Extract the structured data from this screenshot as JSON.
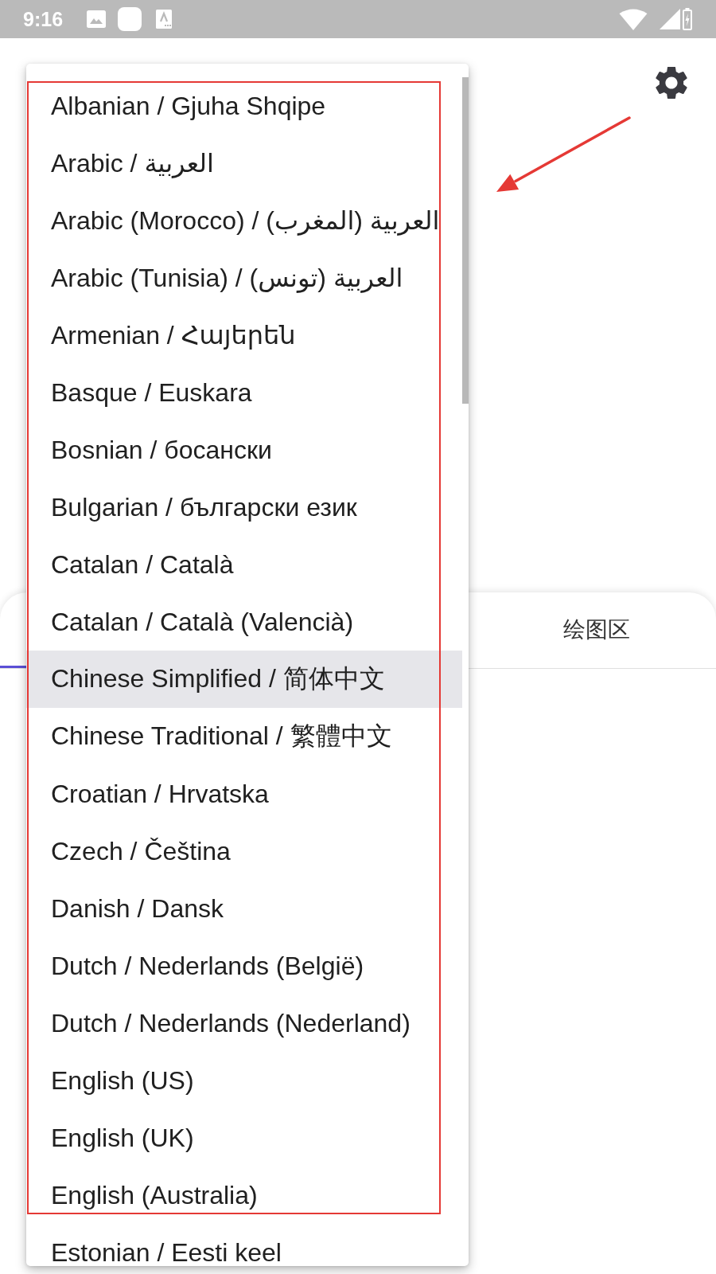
{
  "status_bar": {
    "time": "9:16"
  },
  "tabs": [
    {
      "selected": true
    },
    {
      "label": "绘图区",
      "selected": false
    }
  ],
  "language_menu": {
    "items": [
      {
        "label": "Albanian / Gjuha Shqipe",
        "selected": false
      },
      {
        "label": "Arabic / العربية",
        "selected": false
      },
      {
        "label": "Arabic (Morocco) / العربية (المغرب)",
        "selected": false
      },
      {
        "label": "Arabic (Tunisia) / العربية (تونس)",
        "selected": false
      },
      {
        "label": "Armenian / Հայերեն",
        "selected": false
      },
      {
        "label": "Basque / Euskara",
        "selected": false
      },
      {
        "label": "Bosnian / босански",
        "selected": false
      },
      {
        "label": "Bulgarian / български език",
        "selected": false
      },
      {
        "label": "Catalan / Català",
        "selected": false
      },
      {
        "label": "Catalan / Català (Valencià)",
        "selected": false
      },
      {
        "label": "Chinese Simplified / 简体中文",
        "selected": true
      },
      {
        "label": "Chinese Traditional / 繁體中文",
        "selected": false
      },
      {
        "label": "Croatian / Hrvatska",
        "selected": false
      },
      {
        "label": "Czech / Čeština",
        "selected": false
      },
      {
        "label": "Danish / Dansk",
        "selected": false
      },
      {
        "label": "Dutch / Nederlands (België)",
        "selected": false
      },
      {
        "label": "Dutch / Nederlands (Nederland)",
        "selected": false
      },
      {
        "label": "English (US)",
        "selected": false
      },
      {
        "label": "English (UK)",
        "selected": false
      },
      {
        "label": "English (Australia)",
        "selected": false
      },
      {
        "label": "Estonian / Eesti keel",
        "selected": false
      }
    ]
  }
}
